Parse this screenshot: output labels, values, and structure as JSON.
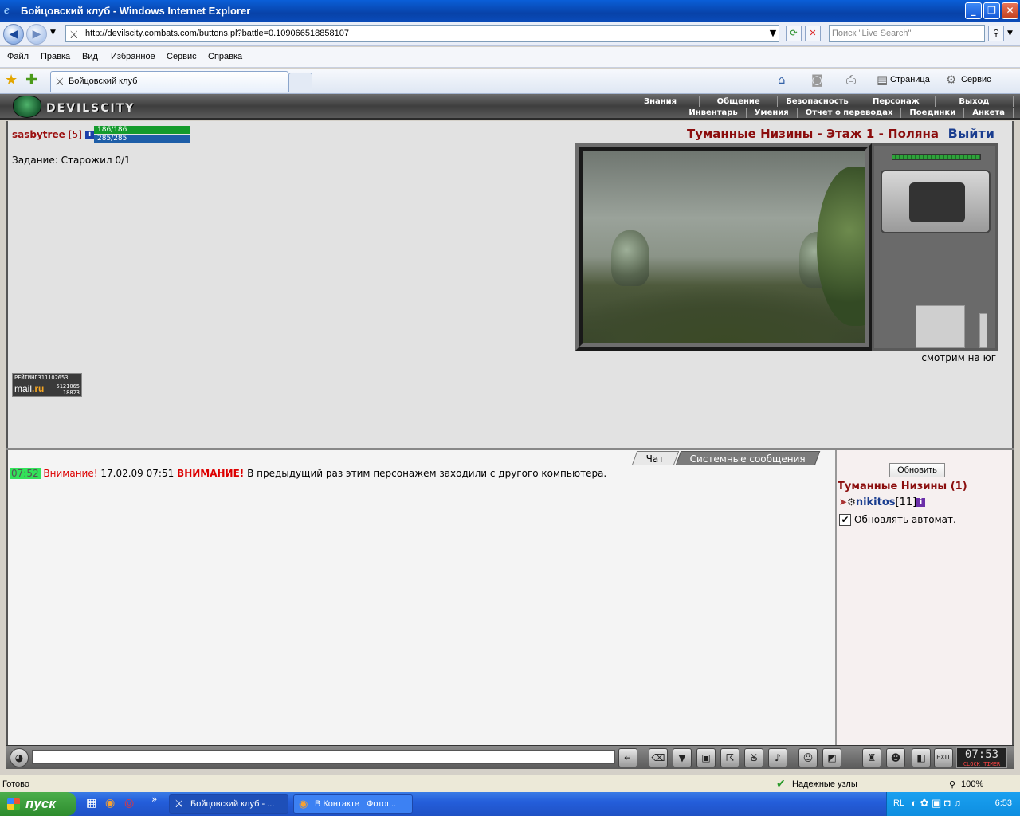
{
  "window": {
    "title": "Бойцовский клуб - Windows Internet Explorer"
  },
  "browser": {
    "address": "http://devilscity.combats.com/buttons.pl?battle=0.109066518858107",
    "search_placeholder": "Поиск \"Live Search\"",
    "menu": [
      "Файл",
      "Правка",
      "Вид",
      "Избранное",
      "Сервис",
      "Справка"
    ],
    "tab_title": "Бойцовский клуб",
    "cmd_page": "Страница",
    "cmd_tools": "Сервис",
    "status_text": "Готово",
    "status_zone": "Надежные узлы",
    "zoom": "100%"
  },
  "game": {
    "logo_text": "DEVILSCITY",
    "nav_top": [
      "Знания",
      "Общение",
      "Безопасность",
      "Персонаж",
      "Выход"
    ],
    "nav_bottom": [
      "Инвентарь",
      "Умения",
      "Отчет о переводах",
      "Поединки",
      "Анкета"
    ],
    "character": {
      "name": "sasbytree",
      "level": "[5]",
      "hp": "186/186",
      "mp": "285/285"
    },
    "hp_fraction": 1.0,
    "mp_fraction": 1.0,
    "quest": "Задание: Старожил 0/1",
    "counter": {
      "label": "РЕЙТИНГ",
      "total": "311102653",
      "logo": "mail",
      "logo_suffix": ".ru",
      "v1": "5121065",
      "v2": "18823"
    },
    "location": "Туманные Низины - Этаж 1 - Поляна",
    "exit_label": "Выйти",
    "facing": "смотрим на юг",
    "chat_tabs": [
      "Чат",
      "Системные сообщения"
    ],
    "chat_messages": [
      {
        "time": "07:52",
        "prefix": "Внимание!",
        "stamp": "17.02.09 07:51",
        "warn": "ВНИМАНИЕ!",
        "text": "В предыдущий раз этим персонажем заходили с другого компьютера."
      }
    ],
    "side": {
      "refresh_label": "Обновить",
      "room_title": "Туманные Низины (1)",
      "user_name": "nikitos",
      "user_level": "[11]",
      "auto_refresh_label": "Обновлять автомат.",
      "auto_refresh_checked": true
    },
    "clock": {
      "time": "07:53",
      "sub_left": "CLOCK",
      "sub_right": "TIMER"
    }
  },
  "taskbar": {
    "start_label": "пуск",
    "items": [
      "Бойцовский клуб - ...",
      "В Контакте | Фотог..."
    ],
    "lang": "RL",
    "time": "6:53"
  }
}
